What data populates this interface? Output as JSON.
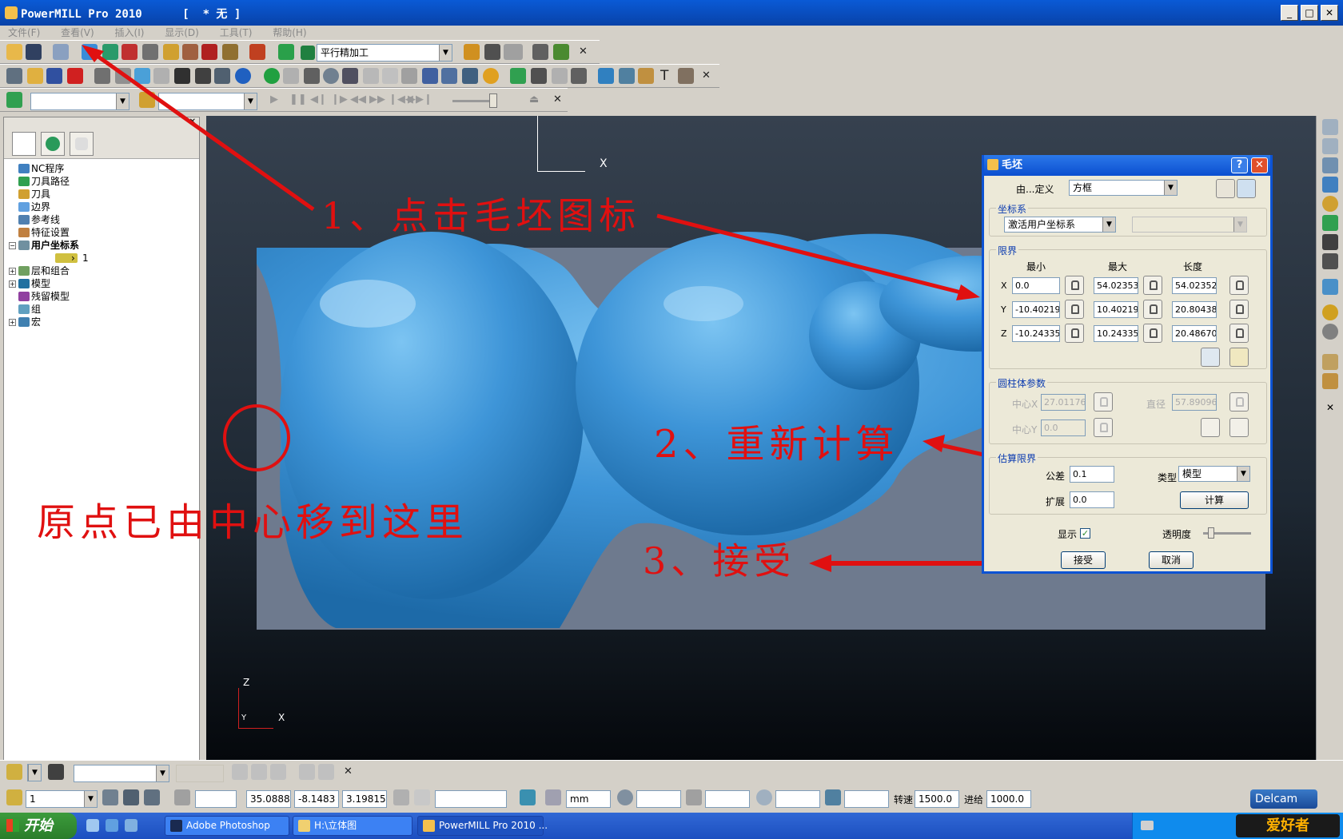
{
  "window": {
    "title": "PowerMILL Pro 2010      [  * 无 ]",
    "min": "_",
    "max": "□",
    "close": "✕"
  },
  "menu": [
    "文件(F)",
    "查看(V)",
    "插入(I)",
    "显示(D)",
    "工具(T)",
    "帮助(H)"
  ],
  "toolbar1": {
    "strategy_combo": "平行精加工"
  },
  "tree": {
    "items": [
      {
        "label": "NC程序",
        "icon": "nc-program-icon",
        "expand": ""
      },
      {
        "label": "刀具路径",
        "icon": "toolpath-icon",
        "expand": ""
      },
      {
        "label": "刀具",
        "icon": "tool-icon",
        "expand": ""
      },
      {
        "label": "边界",
        "icon": "boundary-icon",
        "expand": ""
      },
      {
        "label": "参考线",
        "icon": "pattern-icon",
        "expand": ""
      },
      {
        "label": "特征设置",
        "icon": "featureset-icon",
        "expand": ""
      },
      {
        "label": "用户坐标系",
        "icon": "workplane-icon",
        "expand": "−"
      },
      {
        "label": "1",
        "icon": "workplane-item-icon",
        "expand": ""
      },
      {
        "label": "层和组合",
        "icon": "levels-icon",
        "expand": "+"
      },
      {
        "label": "模型",
        "icon": "model-icon",
        "expand": "+"
      },
      {
        "label": "残留模型",
        "icon": "stockmodel-icon",
        "expand": ""
      },
      {
        "label": "组",
        "icon": "group-icon",
        "expand": ""
      },
      {
        "label": "宏",
        "icon": "macro-icon",
        "expand": "+"
      }
    ]
  },
  "viewport": {
    "axis_top": "X",
    "axis_bottom_z": "Z",
    "axis_bottom_x": "X",
    "axis_bottom_y": "Y"
  },
  "annotations": {
    "a1": "1、点击毛坯图标",
    "a2": "2、重新计算",
    "a3": "3、接受",
    "a4": "原点已由中心移到这里",
    "color": "#e01010"
  },
  "dialog": {
    "title": "毛坯",
    "help": "?",
    "close": "✕",
    "define_label": "由...定义",
    "define_value": "方框",
    "coord_section": "坐标系",
    "coord_value": "激活用户坐标系",
    "limits_section": "限界",
    "col_min": "最小",
    "col_max": "最大",
    "col_len": "长度",
    "rows": [
      {
        "axis": "X",
        "min": "0.0",
        "max": "54.02353",
        "len": "54.023529"
      },
      {
        "axis": "Y",
        "min": "-10.40219",
        "max": "10.40219",
        "len": "20.804382"
      },
      {
        "axis": "Z",
        "min": "-10.24335",
        "max": "10.243354",
        "len": "20.486709"
      }
    ],
    "cyl_section": "圆柱体参数",
    "cyl_cx_label": "中心X",
    "cyl_cx": "27.011765",
    "cyl_cy_label": "中心Y",
    "cyl_cy": "0.0",
    "cyl_dia_label": "直径",
    "cyl_dia": "57.890967",
    "calc_section": "估算限界",
    "tol_label": "公差",
    "tol_value": "0.1",
    "type_label": "类型",
    "type_value": "模型",
    "expand_label": "扩展",
    "expand_value": "0.0",
    "calc_button": "计算",
    "show_label": "显示",
    "opacity_label": "透明度",
    "show_checked": "✓",
    "accept_button": "接受",
    "cancel_button": "取消"
  },
  "statusbar": {
    "workplane_combo": "1",
    "coord_x": "35.0888",
    "coord_y": "-8.1483",
    "coord_z": "3.19815",
    "units": "mm",
    "spindle_label": "转速",
    "spindle_value": "1500.0",
    "feed_label": "进给",
    "feed_value": "1000.0",
    "brand": "Delcam"
  },
  "taskbar": {
    "start": "开始",
    "tasks": [
      "Adobe Photoshop",
      "H:\\立体图",
      "PowerMILL Pro 2010 ..."
    ],
    "tray_logo": "爱好者"
  }
}
